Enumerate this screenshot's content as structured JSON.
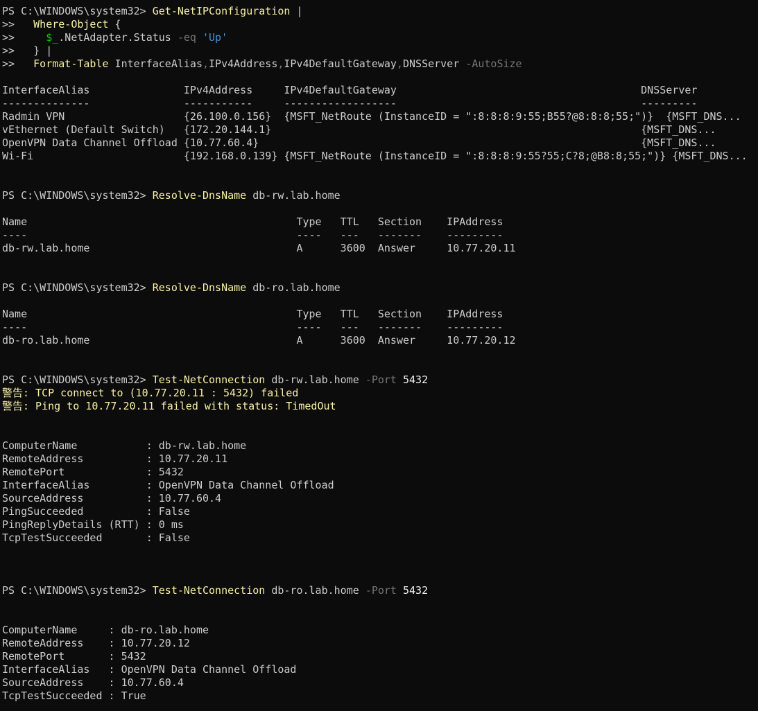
{
  "window": {
    "background": "#0c0c0c",
    "colors": {
      "default": "#cccccc",
      "cmd": "#f9f1a5",
      "param": "#767676",
      "str": "#3a96dd",
      "var": "#16c60c",
      "num": "#f2f2f2",
      "warn": "#f9f1a5",
      "op": "#767676"
    }
  },
  "lines": [
    [
      {
        "t": "PS C:\\WINDOWS\\system32> ",
        "c": "default"
      },
      {
        "t": "Get-NetIPConfiguration",
        "c": "cmd"
      },
      {
        "t": " |",
        "c": "default"
      }
    ],
    [
      {
        "t": ">>   ",
        "c": "default"
      },
      {
        "t": "Where-Object",
        "c": "cmd"
      },
      {
        "t": " {",
        "c": "default"
      }
    ],
    [
      {
        "t": ">>     ",
        "c": "default"
      },
      {
        "t": "$_",
        "c": "var"
      },
      {
        "t": ".NetAdapter.Status ",
        "c": "default"
      },
      {
        "t": "-eq",
        "c": "param"
      },
      {
        "t": " ",
        "c": "default"
      },
      {
        "t": "'Up'",
        "c": "str"
      }
    ],
    [
      {
        "t": ">>   } |",
        "c": "default"
      }
    ],
    [
      {
        "t": ">>   ",
        "c": "default"
      },
      {
        "t": "Format-Table",
        "c": "cmd"
      },
      {
        "t": " InterfaceAlias",
        "c": "default"
      },
      {
        "t": ",",
        "c": "op"
      },
      {
        "t": "IPv4Address",
        "c": "default"
      },
      {
        "t": ",",
        "c": "op"
      },
      {
        "t": "IPv4DefaultGateway",
        "c": "default"
      },
      {
        "t": ",",
        "c": "op"
      },
      {
        "t": "DNSServer ",
        "c": "default"
      },
      {
        "t": "-AutoSize",
        "c": "param"
      }
    ],
    [],
    [
      {
        "t": "InterfaceAlias               IPv4Address     IPv4DefaultGateway                                       DNSServer",
        "c": "default"
      }
    ],
    [
      {
        "t": "--------------               -----------     ------------------                                       ---------",
        "c": "default"
      }
    ],
    [
      {
        "t": "Radmin VPN                   {26.100.0.156}  {MSFT_NetRoute (InstanceID = \":8:8:8:9:55;B55?@8:8:8;55;\")}  {MSFT_DNS...",
        "c": "default"
      }
    ],
    [
      {
        "t": "vEthernet (Default Switch)   {172.20.144.1}                                                           {MSFT_DNS...",
        "c": "default"
      }
    ],
    [
      {
        "t": "OpenVPN Data Channel Offload {10.77.60.4}                                                             {MSFT_DNS...",
        "c": "default"
      }
    ],
    [
      {
        "t": "Wi-Fi                        {192.168.0.139} {MSFT_NetRoute (InstanceID = \":8:8:8:9:55?55;C?8;@B8:8;55;\")} {MSFT_DNS...",
        "c": "default"
      }
    ],
    [],
    [],
    [
      {
        "t": "PS C:\\WINDOWS\\system32> ",
        "c": "default"
      },
      {
        "t": "Resolve-DnsName",
        "c": "cmd"
      },
      {
        "t": " db-rw.lab.home",
        "c": "default"
      }
    ],
    [],
    [
      {
        "t": "Name                                           Type   TTL   Section    IPAddress",
        "c": "default"
      }
    ],
    [
      {
        "t": "----                                           ----   ---   -------    ---------",
        "c": "default"
      }
    ],
    [
      {
        "t": "db-rw.lab.home                                 A      3600  Answer     10.77.20.11",
        "c": "default"
      }
    ],
    [],
    [],
    [
      {
        "t": "PS C:\\WINDOWS\\system32> ",
        "c": "default"
      },
      {
        "t": "Resolve-DnsName",
        "c": "cmd"
      },
      {
        "t": " db-ro.lab.home",
        "c": "default"
      }
    ],
    [],
    [
      {
        "t": "Name                                           Type   TTL   Section    IPAddress",
        "c": "default"
      }
    ],
    [
      {
        "t": "----                                           ----   ---   -------    ---------",
        "c": "default"
      }
    ],
    [
      {
        "t": "db-ro.lab.home                                 A      3600  Answer     10.77.20.12",
        "c": "default"
      }
    ],
    [],
    [],
    [
      {
        "t": "PS C:\\WINDOWS\\system32> ",
        "c": "default"
      },
      {
        "t": "Test-NetConnection",
        "c": "cmd"
      },
      {
        "t": " db-rw.lab.home ",
        "c": "default"
      },
      {
        "t": "-Port",
        "c": "param"
      },
      {
        "t": " ",
        "c": "default"
      },
      {
        "t": "5432",
        "c": "num"
      }
    ],
    [
      {
        "t": "警告: TCP connect to (10.77.20.11 : 5432) failed",
        "c": "warn"
      }
    ],
    [
      {
        "t": "警告: Ping to 10.77.20.11 failed with status: TimedOut",
        "c": "warn"
      }
    ],
    [],
    [],
    [
      {
        "t": "ComputerName           : db-rw.lab.home",
        "c": "default"
      }
    ],
    [
      {
        "t": "RemoteAddress          : 10.77.20.11",
        "c": "default"
      }
    ],
    [
      {
        "t": "RemotePort             : 5432",
        "c": "default"
      }
    ],
    [
      {
        "t": "InterfaceAlias         : OpenVPN Data Channel Offload",
        "c": "default"
      }
    ],
    [
      {
        "t": "SourceAddress          : 10.77.60.4",
        "c": "default"
      }
    ],
    [
      {
        "t": "PingSucceeded          : False",
        "c": "default"
      }
    ],
    [
      {
        "t": "PingReplyDetails (RTT) : 0 ms",
        "c": "default"
      }
    ],
    [
      {
        "t": "TcpTestSucceeded       : False",
        "c": "default"
      }
    ],
    [],
    [],
    [],
    [
      {
        "t": "PS C:\\WINDOWS\\system32> ",
        "c": "default"
      },
      {
        "t": "Test-NetConnection",
        "c": "cmd"
      },
      {
        "t": " db-ro.lab.home ",
        "c": "default"
      },
      {
        "t": "-Port",
        "c": "param"
      },
      {
        "t": " ",
        "c": "default"
      },
      {
        "t": "5432",
        "c": "num"
      }
    ],
    [],
    [],
    [
      {
        "t": "ComputerName     : db-ro.lab.home",
        "c": "default"
      }
    ],
    [
      {
        "t": "RemoteAddress    : 10.77.20.12",
        "c": "default"
      }
    ],
    [
      {
        "t": "RemotePort       : 5432",
        "c": "default"
      }
    ],
    [
      {
        "t": "InterfaceAlias   : OpenVPN Data Channel Offload",
        "c": "default"
      }
    ],
    [
      {
        "t": "SourceAddress    : 10.77.60.4",
        "c": "default"
      }
    ],
    [
      {
        "t": "TcpTestSucceeded : True",
        "c": "default"
      }
    ]
  ]
}
